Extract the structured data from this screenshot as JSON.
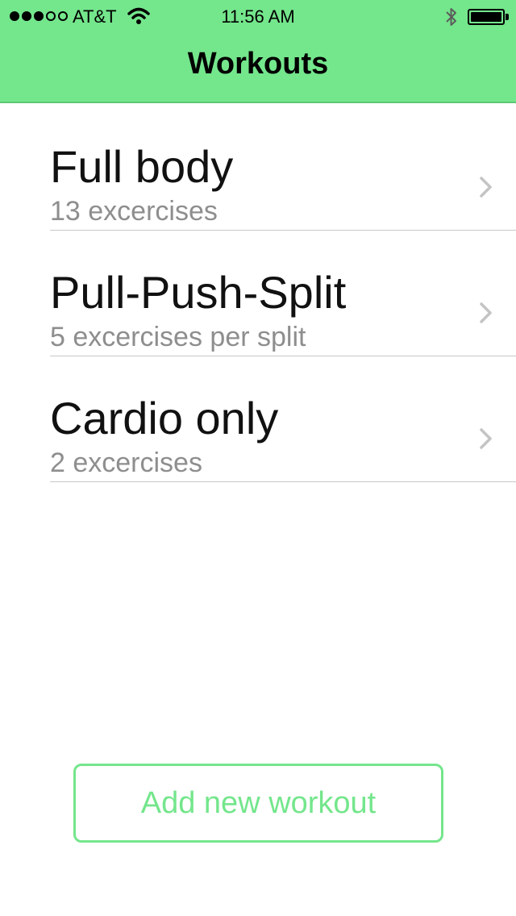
{
  "status_bar": {
    "carrier": "AT&T",
    "time": "11:56 AM",
    "signal_icon": "signal-dots",
    "wifi_icon": "wifi-icon",
    "bluetooth_icon": "bluetooth-icon",
    "battery_icon": "battery-icon",
    "battery_level": 1.0
  },
  "nav": {
    "title": "Workouts"
  },
  "workouts": [
    {
      "title": "Full body",
      "subtitle": "13 excercises"
    },
    {
      "title": "Pull-Push-Split",
      "subtitle": "5 excercises per split"
    },
    {
      "title": "Cardio only",
      "subtitle": "2 excercises"
    }
  ],
  "add_button": {
    "label": "Add new workout"
  },
  "colors": {
    "accent": "#74e68c",
    "text": "#111111",
    "subtext": "#8e8e8e",
    "divider": "#c8c8c8"
  }
}
